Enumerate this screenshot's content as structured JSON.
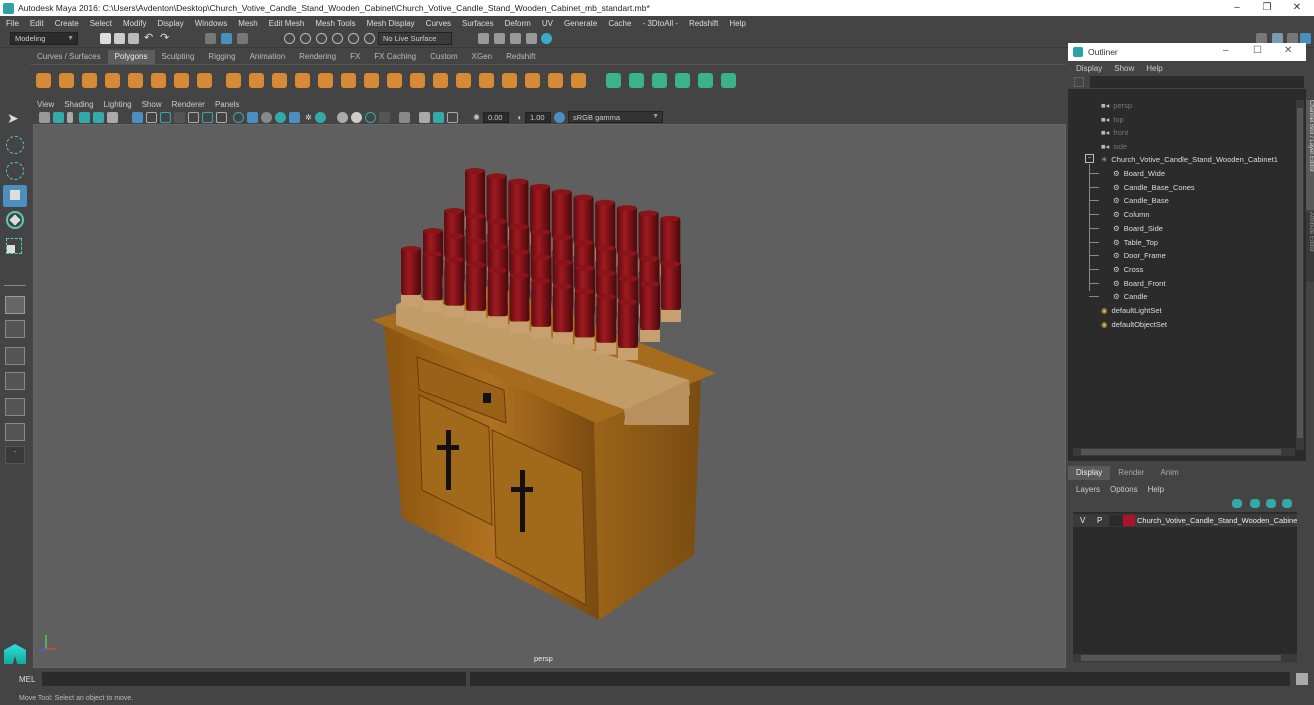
{
  "window": {
    "title": "Autodesk Maya 2016: C:\\Users\\Avdenton\\Desktop\\Church_Votive_Candle_Stand_Wooden_Cabinet\\Church_Votive_Candle_Stand_Wooden_Cabinet_mb_standart.mb*",
    "minimize": "–",
    "restore": "❐",
    "close": "✕"
  },
  "menubar": [
    "File",
    "Edit",
    "Create",
    "Select",
    "Modify",
    "Display",
    "Windows",
    "Mesh",
    "Edit Mesh",
    "Mesh Tools",
    "Mesh Display",
    "Curves",
    "Surfaces",
    "Deform",
    "UV",
    "Generate",
    "Cache",
    "- 3DtoAll -",
    "Redshift",
    "Help"
  ],
  "statusline": {
    "mode": "Modeling",
    "live_surface": "No Live Surface"
  },
  "shelf": {
    "tabs": [
      "Curves / Surfaces",
      "Polygons",
      "Sculpting",
      "Rigging",
      "Animation",
      "Rendering",
      "FX",
      "FX Caching",
      "Custom",
      "XGen",
      "Redshift"
    ],
    "active": "Polygons"
  },
  "viewport": {
    "menu": [
      "View",
      "Shading",
      "Lighting",
      "Show",
      "Renderer",
      "Panels"
    ],
    "exposure": "0.00",
    "gamma": "1.00",
    "color_space": "sRGB gamma",
    "camera": "persp"
  },
  "outliner": {
    "title": "Outliner",
    "menu": [
      "Display",
      "Show",
      "Help"
    ],
    "cameras": [
      "persp",
      "top",
      "front",
      "side"
    ],
    "root": "Church_Votive_Candle_Stand_Wooden_Cabinet1",
    "children": [
      "Board_Wide",
      "Candle_Base_Cones",
      "Candle_Base",
      "Column",
      "Board_Side",
      "Table_Top",
      "Door_Frame",
      "Cross",
      "Board_Front",
      "Candle"
    ],
    "sets": [
      "defaultLightSet",
      "defaultObjectSet"
    ]
  },
  "side_tabs": [
    "Channel Box / Layer Editor",
    "Attribute Editor"
  ],
  "layers": {
    "tabs": [
      "Display",
      "Render",
      "Anim"
    ],
    "active": "Display",
    "menu": [
      "Layers",
      "Options",
      "Help"
    ],
    "rows": [
      {
        "v": "V",
        "p": "P",
        "color": "#b0102a",
        "name": "Church_Votive_Candle_Stand_Wooden_Cabinet"
      }
    ]
  },
  "command": {
    "label": "MEL"
  },
  "help_line": "Move Tool: Select an object to move."
}
